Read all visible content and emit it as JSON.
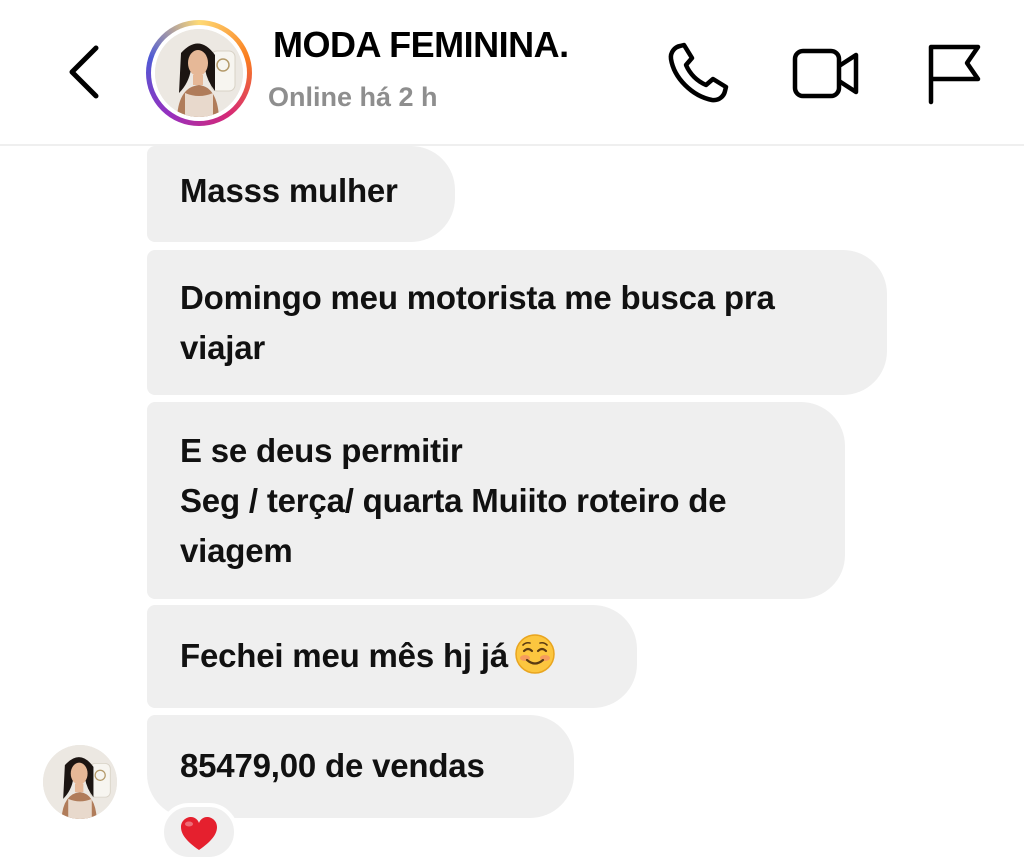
{
  "header": {
    "title": "MODA FEMININA.",
    "status": "Online há 2 h",
    "back_icon": "chevron-left-icon",
    "call_icon": "phone-icon",
    "video_icon": "video-camera-icon",
    "report_icon": "flag-icon"
  },
  "messages": [
    {
      "lines": [
        "Masss mulher"
      ]
    },
    {
      "lines": [
        "Domingo meu motorista me busca pra",
        "viajar"
      ]
    },
    {
      "lines": [
        "E se deus permitir",
        "Seg / terça/ quarta Muiito roteiro de",
        "viagem"
      ]
    },
    {
      "lines": [
        "Fechei meu mês hj já"
      ],
      "emoji": "smiling-face-icon"
    },
    {
      "lines": [
        "85479,00 de vendas"
      ],
      "reaction": "heart-icon"
    }
  ],
  "colors": {
    "bubble": "#efefef",
    "text": "#111111",
    "muted": "#8e8e8e",
    "heart": "#e5202e"
  }
}
